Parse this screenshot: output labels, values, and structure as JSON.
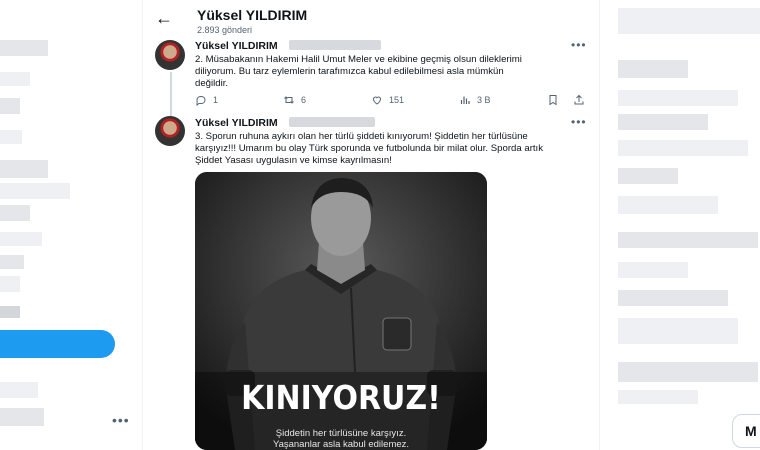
{
  "profile": {
    "name": "Yüksel YILDIRIM",
    "post_count": "2.893 gönderi"
  },
  "tweets": [
    {
      "author": "Yüksel YILDIRIM",
      "text": "2. Müsabakanın Hakemi Halil Umut Meler ve ekibine geçmiş olsun dileklerimi diliyorum. Bu tarz eylemlerin tarafımızca kabul edilebilmesi asla mümkün değildir.",
      "replies": "1",
      "retweets": "6",
      "likes": "151",
      "views": "3 B"
    },
    {
      "author": "Yüksel YILDIRIM",
      "text": "3. Sporun ruhuna aykırı olan her türlü şiddeti kınıyorum! Şiddetin her türlüsüne karşıyız!!! Umarım bu olay Türk sporunda ve futbolunda bir milat olur. Sporda artık Şiddet Yasası uygulasın ve kimse kayrılmasın!",
      "media": {
        "headline": "KINIYORUZ!",
        "caption_line1": "Şiddetin her türlüsüne karşıyız.",
        "caption_line2": "Yaşananlar asla kabul edilemez."
      }
    }
  ],
  "right_button": "M",
  "icons": {
    "back": "back-arrow-icon",
    "more": "more-dots-icon",
    "reply": "reply-icon",
    "retweet": "retweet-icon",
    "like": "heart-icon",
    "views": "views-icon",
    "bookmark": "bookmark-icon",
    "share": "share-icon"
  }
}
